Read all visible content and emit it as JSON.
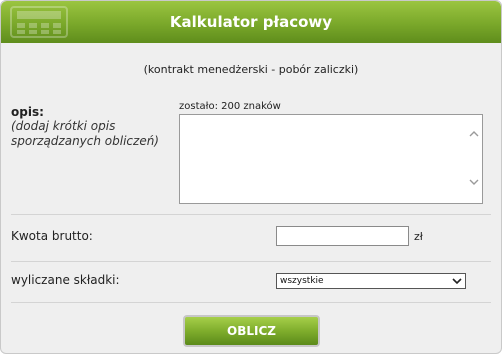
{
  "header": {
    "title": "Kalkulator płacowy"
  },
  "subtitle": "(kontrakt menedżerski - pobór zaliczki)",
  "description": {
    "label": "opis:",
    "hint": "(dodaj krótki opis sporządzanych obliczeń)",
    "remaining": "zostało: 200 znaków",
    "value": ""
  },
  "gross": {
    "label": "Kwota brutto:",
    "value": "",
    "unit": "zł"
  },
  "contributions": {
    "label": "wyliczane składki:",
    "selected": "wszystkie"
  },
  "submit": {
    "label": "OBLICZ"
  },
  "colors": {
    "header_green": "#7aa82a",
    "button_green": "#7fad2c",
    "panel_bg": "#efefef"
  }
}
